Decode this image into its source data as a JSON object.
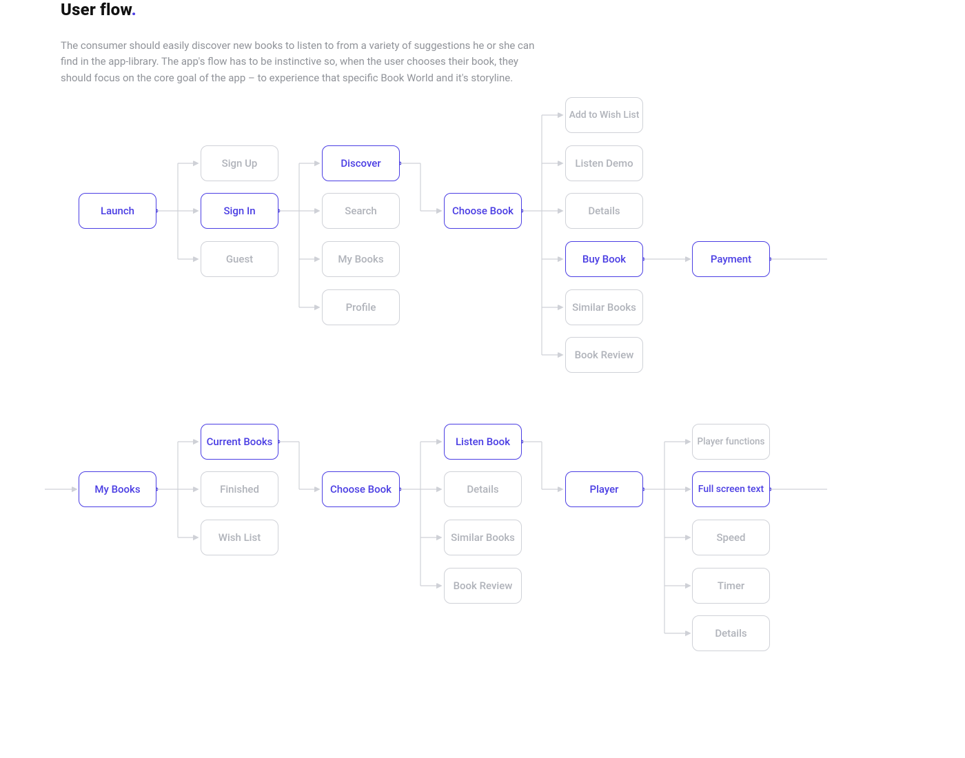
{
  "heading": {
    "title": "User flow",
    "dot": "."
  },
  "intro": "The consumer should easily discover new books to listen to from a variety of suggestions he or she can find in the app-library. The app's flow has to be instinctive so, when the user chooses their book, they should focus on the core goal of the app – to experience that specific Book World and it's storyline.",
  "nodes": {
    "launch": "Launch",
    "signup": "Sign Up",
    "signin": "Sign In",
    "guest": "Guest",
    "discover": "Discover",
    "search": "Search",
    "mybooks1": "My Books",
    "profile": "Profile",
    "choosebook1": "Choose Book",
    "wishlist_add": "Add to Wish List",
    "listendemo": "Listen Demo",
    "details1": "Details",
    "buybook": "Buy Book",
    "similar1": "Similar Books",
    "review1": "Book Review",
    "payment": "Payment",
    "mybooks2": "My Books",
    "current": "Current Books",
    "finished": "Finished",
    "wishlist": "Wish List",
    "choosebook2": "Choose Book",
    "listenbook": "Listen Book",
    "details2": "Details",
    "similar2": "Similar Books",
    "review2": "Book Review",
    "player": "Player",
    "playerfn": "Player functions",
    "fullscreen": "Full screen text",
    "speed": "Speed",
    "timer": "Timer",
    "details3": "Details"
  }
}
